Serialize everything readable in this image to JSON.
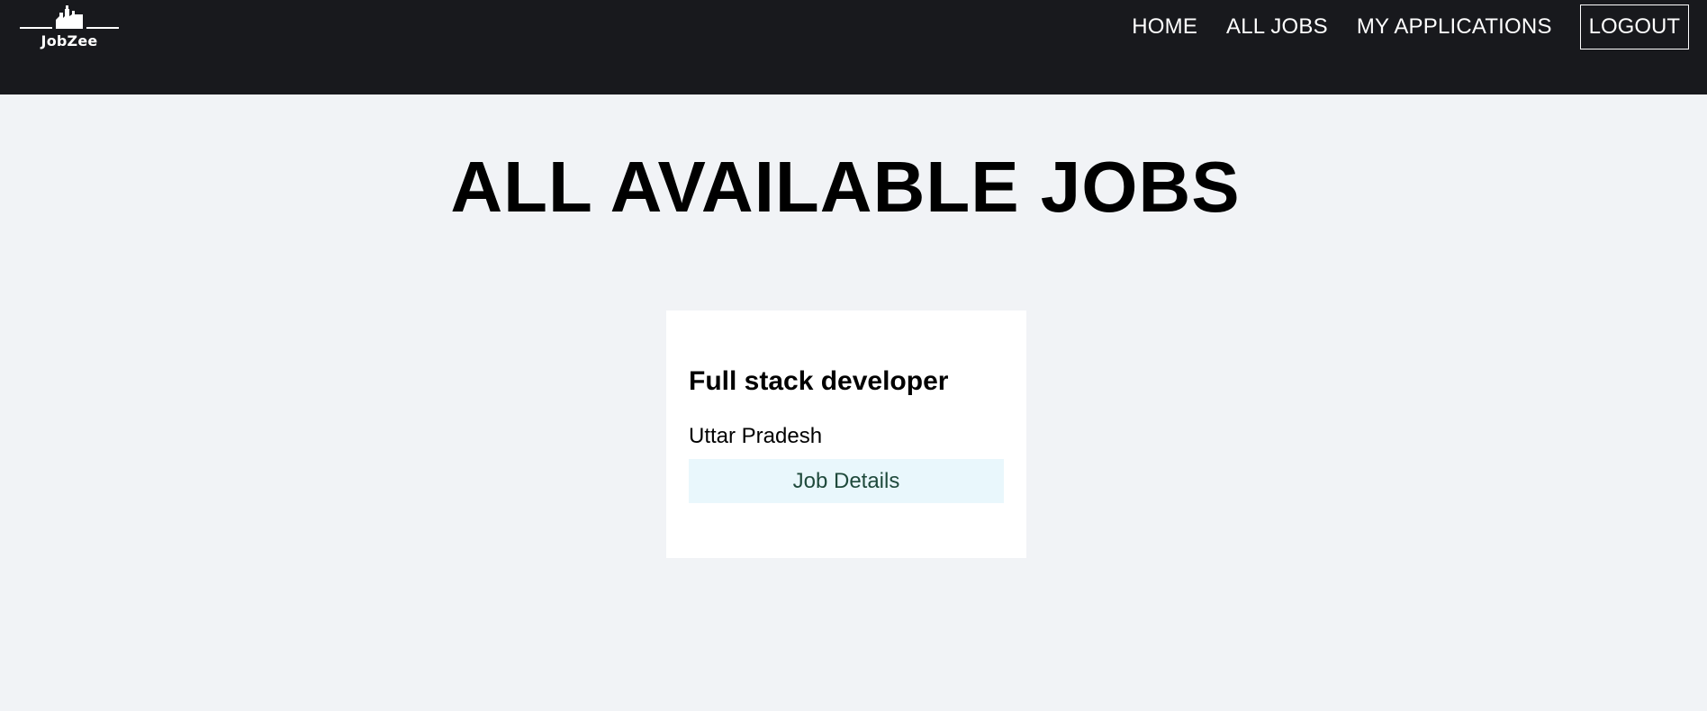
{
  "brand": {
    "name": "JobZee",
    "icon": "factory-icon"
  },
  "nav": {
    "items": [
      "HOME",
      "ALL JOBS",
      "MY APPLICATIONS"
    ],
    "logout_label": "LOGOUT"
  },
  "main": {
    "title": "ALL AVAILABLE JOBS",
    "jobs": [
      {
        "title": "Full stack developer",
        "location": "Uttar Pradesh",
        "button_label": "Job Details"
      }
    ]
  },
  "colors": {
    "navbar_bg": "#18191d",
    "page_bg": "#f1f3f6",
    "card_bg": "#ffffff",
    "button_bg": "#e9f7fc",
    "button_text": "#1f4a3c"
  }
}
